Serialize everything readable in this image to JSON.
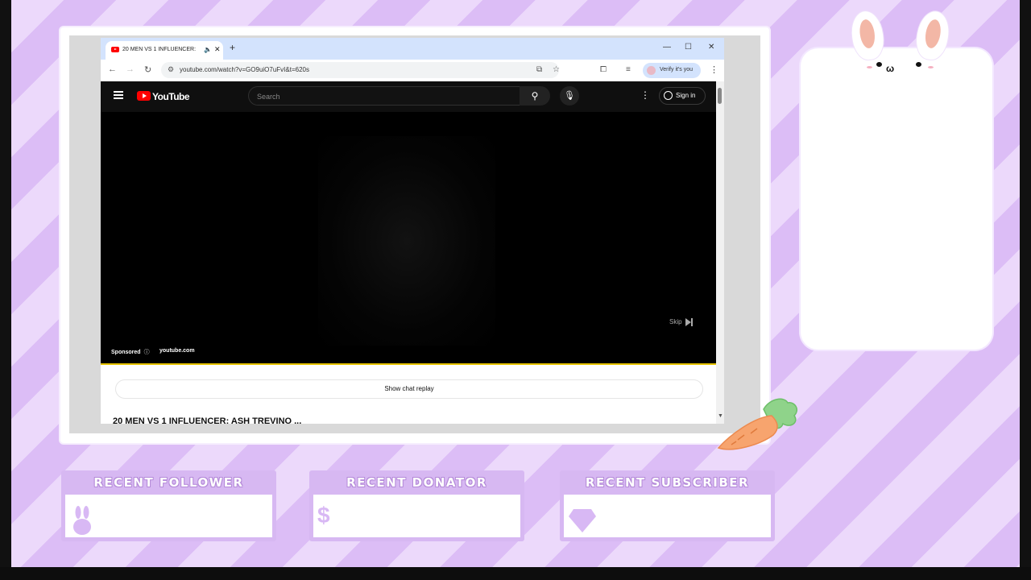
{
  "browser": {
    "tab_title": "20 MEN VS 1 INFLUENCER:",
    "new_tab": "+",
    "url": "youtube.com/watch?v=GO9uiO7uFvI&t=620s",
    "profile_label": "Verify it's you"
  },
  "youtube": {
    "logo": "YouTube",
    "search_placeholder": "Search",
    "sign_in": "Sign in",
    "ad": {
      "sponsored": "Sponsored",
      "domain": "youtube.com",
      "skip": "Skip"
    },
    "chat_replay": "Show chat replay",
    "video_title": "20 MEN VS 1 INFLUENCER: ASH TREVINO ..."
  },
  "overlay": {
    "widgets": [
      {
        "label": "RECENT FOLLOWER",
        "icon": "bunny-icon"
      },
      {
        "label": "RECENT DONATOR",
        "icon": "dollar-icon",
        "symbol": "$"
      },
      {
        "label": "RECENT SUBSCRIBER",
        "icon": "diamond-icon"
      }
    ],
    "colors": {
      "stripe_light": "#ecd9fb",
      "stripe_dark": "#dcbdf6",
      "widget_border": "#d7b8f2",
      "youtube_red": "#ff0000"
    }
  }
}
